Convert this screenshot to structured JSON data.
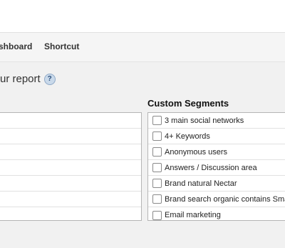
{
  "tabs": [
    {
      "label": "shboard"
    },
    {
      "label": "Shortcut"
    }
  ],
  "report": {
    "heading": "ur report",
    "help_glyph": "?"
  },
  "default_segments": {
    "rows": 7
  },
  "custom_segments": {
    "title": "Custom Segments",
    "items": [
      {
        "label": "3 main social networks",
        "checked": false
      },
      {
        "label": "4+ Keywords",
        "checked": false
      },
      {
        "label": "Anonymous users",
        "checked": false
      },
      {
        "label": "Answers / Discussion area",
        "checked": false
      },
      {
        "label": "Brand natural Nectar",
        "checked": false
      },
      {
        "label": "Brand search organic contains Sma",
        "checked": false
      },
      {
        "label": "Email marketing",
        "checked": false
      }
    ]
  }
}
